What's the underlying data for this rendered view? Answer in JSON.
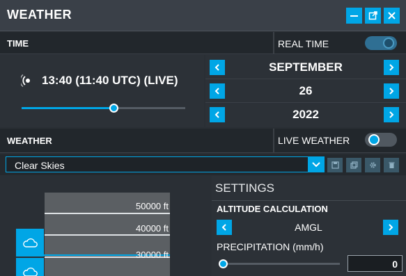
{
  "window": {
    "title": "WEATHER",
    "accent": "#00a6e6"
  },
  "time_section": {
    "label": "TIME",
    "real_time_label": "REAL TIME",
    "real_time_on": true,
    "time_display": "13:40 (11:40 UTC) (LIVE)",
    "time_slider_fraction": 0.56,
    "month": "SEPTEMBER",
    "day": "26",
    "year": "2022"
  },
  "weather_section": {
    "label": "WEATHER",
    "live_weather_label": "LIVE WEATHER",
    "live_weather_on": false,
    "preset_value": "Clear Skies"
  },
  "altitude_diagram": {
    "levels": [
      "50000 ft",
      "40000 ft",
      "30000 ft"
    ]
  },
  "settings": {
    "title": "SETTINGS",
    "altitude_calc_label": "ALTITUDE CALCULATION",
    "altitude_calc_value": "AMGL",
    "precip_label": "PRECIPITATION (mm/h)",
    "precip_value": "0",
    "precip_slider_fraction": 0.0
  }
}
